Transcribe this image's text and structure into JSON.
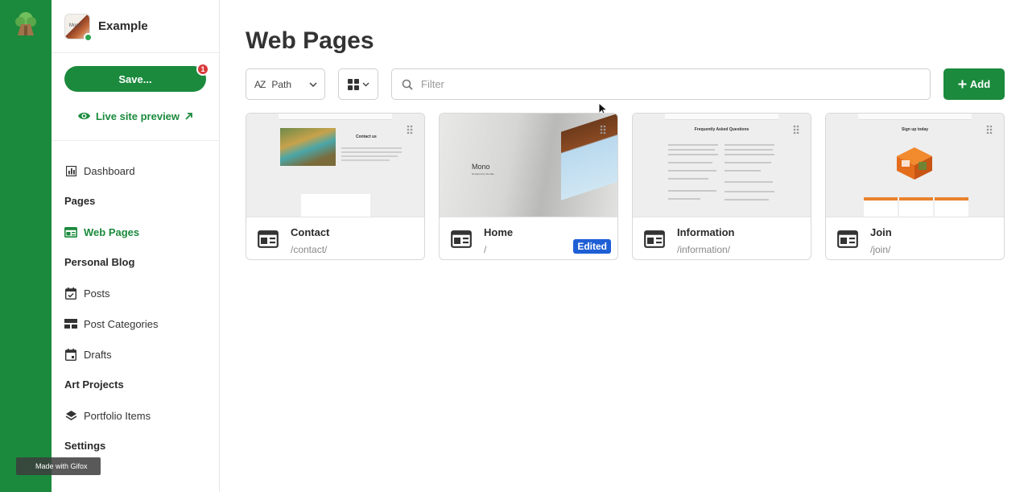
{
  "colors": {
    "brand_green": "#1b8a3d",
    "badge_red": "#d93a3a",
    "edited_blue": "#1f5fd6"
  },
  "site": {
    "name": "Example",
    "thumb_text": "Mono"
  },
  "save": {
    "label": "Save...",
    "badge": "1"
  },
  "live_preview": {
    "label": "Live site preview",
    "icon": "eye-icon",
    "arrow_icon": "external-arrow-icon"
  },
  "nav": {
    "dashboard": "Dashboard",
    "pages_group": "Pages",
    "web_pages": "Web Pages",
    "blog_group": "Personal Blog",
    "posts": "Posts",
    "post_categories": "Post Categories",
    "drafts": "Drafts",
    "art_group": "Art Projects",
    "portfolio_items": "Portfolio Items",
    "settings_group": "Settings"
  },
  "watermark": {
    "text": "Made with Gifox"
  },
  "main": {
    "title": "Web Pages",
    "sort": {
      "icon_text": "AZ",
      "label": "Path"
    },
    "filter": {
      "placeholder": "Filter"
    },
    "add": {
      "label": "Add",
      "icon": "plus-icon"
    },
    "cards": [
      {
        "name": "Contact",
        "path": "/contact/",
        "thumb_title": "Contact us"
      },
      {
        "name": "Home",
        "path": "/",
        "status": "Edited",
        "thumb_title": "Mono",
        "thumb_sub": "Designed by Sundae"
      },
      {
        "name": "Information",
        "path": "/information/",
        "thumb_title": "Frequently Asked Questions"
      },
      {
        "name": "Join",
        "path": "/join/",
        "thumb_title": "Sign up today"
      }
    ]
  }
}
